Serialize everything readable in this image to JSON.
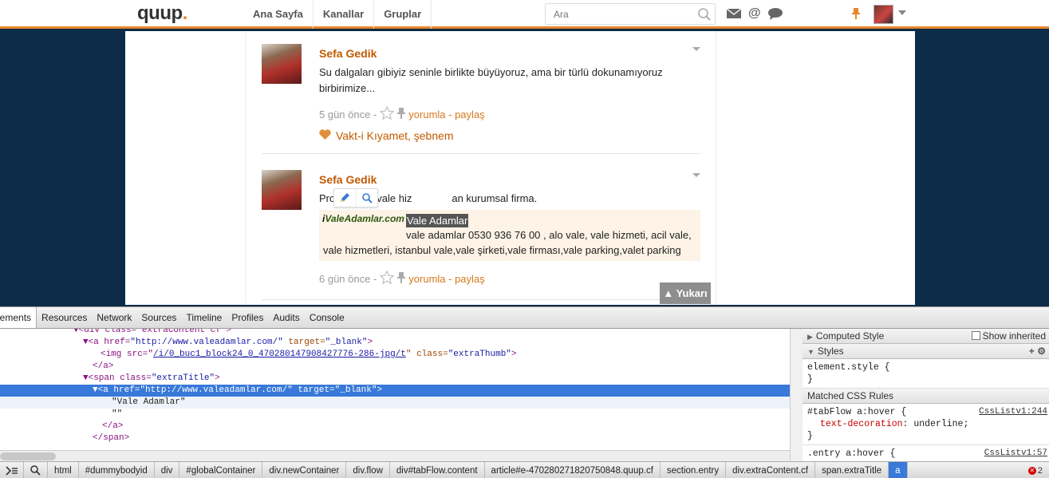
{
  "header": {
    "logo": "quup",
    "nav": [
      "Ana Sayfa",
      "Kanallar",
      "Gruplar"
    ],
    "search_placeholder": "Ara"
  },
  "entries": [
    {
      "author": "Sefa Gedik",
      "text": "Su dalgaları gibiyiz seninle birlikte büyüyoruz, ama bir türlü dokunamıyoruz birbirimize...",
      "time": "5 gün önce -",
      "links": "yorumla - paylaş",
      "favorite": "Vakt-i Kıyamet, şebnem"
    },
    {
      "author": "Sefa Gedik",
      "text_start": "Profesyonel vale hiz",
      "text_end": "an kurumsal firma.",
      "extra_logo": "ValeAdamlar.com",
      "extra_title": "Vale Adamlar",
      "extra_desc_1": "vale adamlar 0530 936 76 00 , alo vale, vale hizmeti, acil vale,",
      "extra_desc_2": "vale hizmetleri, istanbul vale,vale şirketi,vale firması,vale parking,valet parking",
      "time": "6 gün önce -",
      "links": "yorumla - paylaş"
    }
  ],
  "scroll_top": "▲ Yukarı",
  "devtools": {
    "tabs": [
      "Elements",
      "Resources",
      "Network",
      "Sources",
      "Timeline",
      "Profiles",
      "Audits",
      "Console"
    ],
    "dom": {
      "l1": "▼<div class=\"extraContent cf\">",
      "l2_a": "▼<a href=",
      "l2_v": "\"http://www.valeadamlar.com/\"",
      "l2_b": " target=",
      "l2_t": "\"_blank\"",
      "l2_c": ">",
      "l3_a": "<img src=\"",
      "l3_url": "/i/0_buc1_block24_0_470280147908427776-286-jpg/t",
      "l3_b": "\" class=",
      "l3_v": "\"extraThumb\"",
      "l3_c": ">",
      "l4": "</a>",
      "l5_a": "▼<span class=",
      "l5_v": "\"extraTitle\"",
      "l5_c": ">",
      "l6": "▼<a href=\"http://www.valeadamlar.com/\" target=\"_blank\">",
      "l7": "\"Vale Adamlar\"",
      "l8": "\"\"",
      "l9": "</a>",
      "l10": "</span>"
    },
    "side": {
      "computed": "Computed Style",
      "show_inherited": "Show inherited",
      "styles": "Styles",
      "element_style": "element.style {",
      "close": "}",
      "matched": "Matched CSS Rules",
      "rule1_sel": "#tabFlow a:hover {",
      "rule1_src": "CssListv1:244",
      "rule1_prop": "text-decoration",
      "rule1_val": ": underline;",
      "rule2_sel": ".entry a:hover {",
      "rule2_src": "CssListv1:57"
    },
    "crumbs": [
      "html",
      "#dummybodyid",
      "div",
      "#globalContainer",
      "div.newContainer",
      "div.flow",
      "div#tabFlow.content",
      "article#e-470280271820750848.quup.cf",
      "section.entry",
      "div.extraContent.cf",
      "span.extraTitle",
      "a"
    ],
    "errors": "2"
  }
}
